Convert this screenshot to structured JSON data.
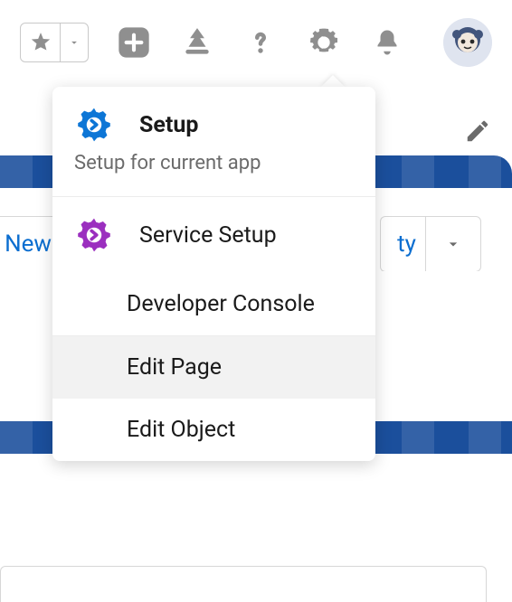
{
  "menu": {
    "setup_label": "Setup",
    "setup_subtitle": "Setup for current app",
    "service_setup_label": "Service Setup",
    "developer_console_label": "Developer Console",
    "edit_page_label": "Edit Page",
    "edit_object_label": "Edit Object"
  },
  "buttons": {
    "new_label": "New",
    "ty_fragment": "ty"
  },
  "colors": {
    "setup_gear": "#0d76d6",
    "service_gear": "#9b2fbf"
  }
}
